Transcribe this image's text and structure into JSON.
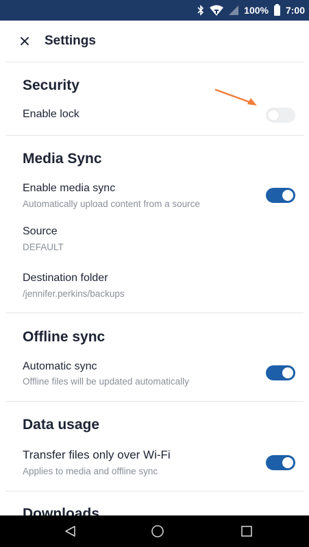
{
  "status_bar": {
    "bluetooth_icon": "bluetooth-icon",
    "wifi_icon": "wifi-icon",
    "signal_icon": "signal-icon",
    "battery": "100%",
    "time": "7:00"
  },
  "header": {
    "title": "Settings"
  },
  "sections": {
    "security": {
      "title": "Security",
      "enable_lock": {
        "label": "Enable lock",
        "on": false
      }
    },
    "media_sync": {
      "title": "Media Sync",
      "enable_media_sync": {
        "label": "Enable media sync",
        "sub": "Automatically upload content from a source",
        "on": true
      },
      "source": {
        "label": "Source",
        "value": "DEFAULT"
      },
      "destination": {
        "label": "Destination folder",
        "value": "/jennifer.perkins/backups"
      }
    },
    "offline_sync": {
      "title": "Offline sync",
      "automatic_sync": {
        "label": "Automatic sync",
        "sub": "Offline files will be updated automatically",
        "on": true
      }
    },
    "data_usage": {
      "title": "Data usage",
      "wifi_only": {
        "label": "Transfer files only over Wi-Fi",
        "sub": "Applies to media and offline sync",
        "on": true
      }
    },
    "downloads": {
      "title": "Downloads"
    }
  },
  "colors": {
    "accent": "#1d5fa8",
    "status_bar": "#1d3966",
    "annotation_arrow": "#f07d3a"
  }
}
